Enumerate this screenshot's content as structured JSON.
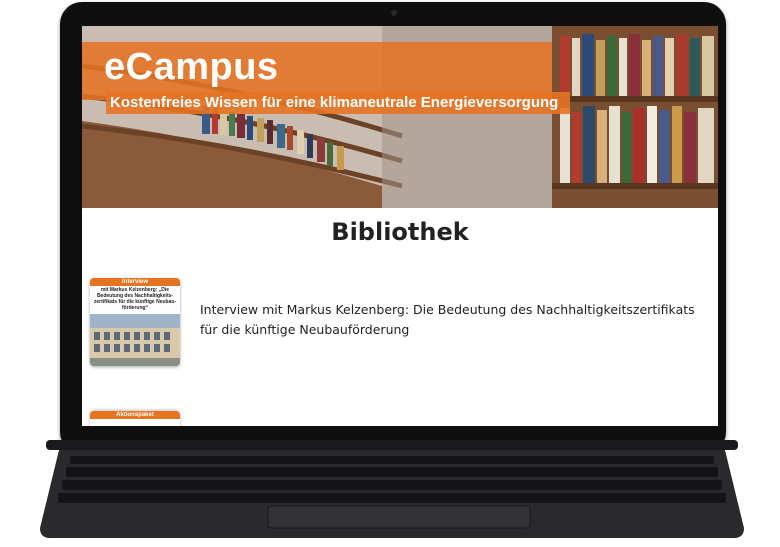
{
  "banner": {
    "title": "eCampus",
    "subtitle": "Kostenfreies Wissen für eine klimaneutrale Energieversorgung"
  },
  "page": {
    "title": "Bibliothek"
  },
  "items": [
    {
      "tag": "Interview",
      "thumb_caption": "mit Markus Kelzenberg: „Die Bedeutung des Nachhaltigkeits-zertifikats für die künftige Neubau-förderung“",
      "text": "Interview mit Markus Kelzenberg: Die Bedeutung des Nachhaltigkeitszertifikats für die künftige Neubauförderung"
    },
    {
      "tag": "Aktionspaket"
    }
  ],
  "colors": {
    "accent": "#e5731f",
    "device": "#0f0f10"
  }
}
